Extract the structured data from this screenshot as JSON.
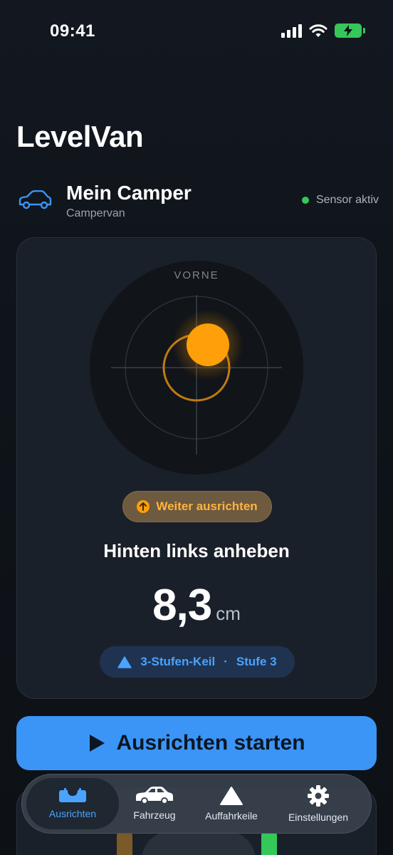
{
  "status_bar": {
    "time": "09:41",
    "icons": [
      "signal-icon",
      "wifi-icon",
      "battery-charging-icon"
    ]
  },
  "app": {
    "title": "LevelVan"
  },
  "vehicle": {
    "name": "Mein Camper",
    "type": "Campervan",
    "icon": "car-icon",
    "sensor_status": "Sensor aktiv",
    "sensor_color": "#34c759"
  },
  "level": {
    "direction_label": "VORNE",
    "status_pill": "Weiter ausrichten",
    "instruction": "Hinten links anheben",
    "value": "8,3",
    "unit": "cm",
    "wedge": {
      "name": "3-Stufen-Keil",
      "separator": "·",
      "stage": "Stufe 3"
    }
  },
  "actions": {
    "start": "Ausrichten starten"
  },
  "tabs": [
    {
      "label": "Ausrichten",
      "icon": "level-icon",
      "active": true
    },
    {
      "label": "Fahrzeug",
      "icon": "car-icon",
      "active": false
    },
    {
      "label": "Auffahrkeile",
      "icon": "triangle-icon",
      "active": false
    },
    {
      "label": "Einstellungen",
      "icon": "gear-icon",
      "active": false
    }
  ],
  "colors": {
    "accent": "#3b95f6",
    "warning": "#ff9f0a",
    "success": "#34c759",
    "background": "#0e1217",
    "card": "#1a2029"
  }
}
